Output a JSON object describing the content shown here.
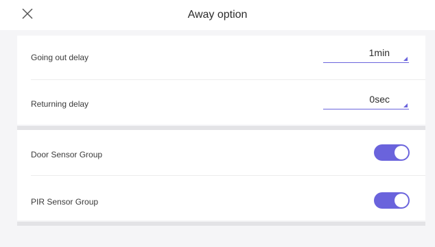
{
  "header": {
    "title": "Away option",
    "close_icon": "close-icon"
  },
  "delays": {
    "going_out": {
      "label": "Going out delay",
      "value": "1min"
    },
    "returning": {
      "label": "Returning delay",
      "value": "0sec"
    }
  },
  "sensor_groups": {
    "door": {
      "label": "Door Sensor Group",
      "enabled": true
    },
    "pir": {
      "label": "PIR Sensor Group",
      "enabled": true
    }
  },
  "colors": {
    "accent": "#6a63dc",
    "background": "#f5f5f7",
    "surface": "#ffffff"
  }
}
